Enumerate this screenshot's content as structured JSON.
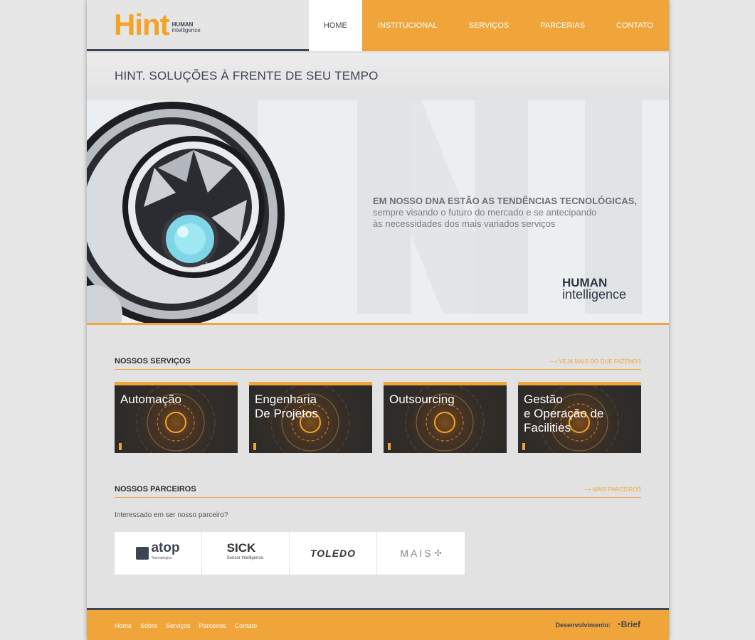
{
  "header": {
    "logo": {
      "mark": "Hint",
      "line1": "HUMAN",
      "line2": "intelligence"
    },
    "nav": [
      "HOME",
      "INSTITUCIONAL",
      "SERVIÇOS",
      "PARCERIAS",
      "CONTATO"
    ]
  },
  "title": "HINT. SOLUÇÕES À FRENTE DE SEU TEMPO",
  "hero": {
    "lead": "EM NOSSO DNA ESTÃO AS TENDÊNCIAS TECNOLÓGICAS,",
    "line2": "sempre visando o futuro do mercado e se antecipando",
    "line3": "às necessidades dos mais variados serviços",
    "brand1": "HUMAN",
    "brand2": "intelligence"
  },
  "services": {
    "heading": "NOSSOS SERVIÇOS",
    "more": "⟶ VEJA MAIS DO QUE FAZEMOS",
    "items": [
      "Automação",
      "Engenharia\nDe Projetos",
      "Outsourcing",
      "Gestão\ne Operação de\nFacilities"
    ]
  },
  "partners": {
    "heading": "NOSSOS PARCEIROS",
    "more": "⟶ MAIS PARCEIROS",
    "question": "Interessado em ser nosso parceiro?",
    "logos": [
      {
        "name": "atop",
        "sub": "Technologies"
      },
      {
        "name": "SICK",
        "sub": "Sensor Intelligence."
      },
      {
        "name": "TOLEDO",
        "sub": ""
      },
      {
        "name": "MAIS",
        "sub": ""
      }
    ]
  },
  "footer": {
    "links": [
      "Home",
      "Sobre",
      "Serviços",
      "Parceiros",
      "Contato"
    ],
    "dev_label": "Desenvolvimento:",
    "dev_brand": "Brief"
  },
  "colors": {
    "accent": "#f0a53b",
    "navy": "#3d4453",
    "page": "#e2e2e2"
  }
}
